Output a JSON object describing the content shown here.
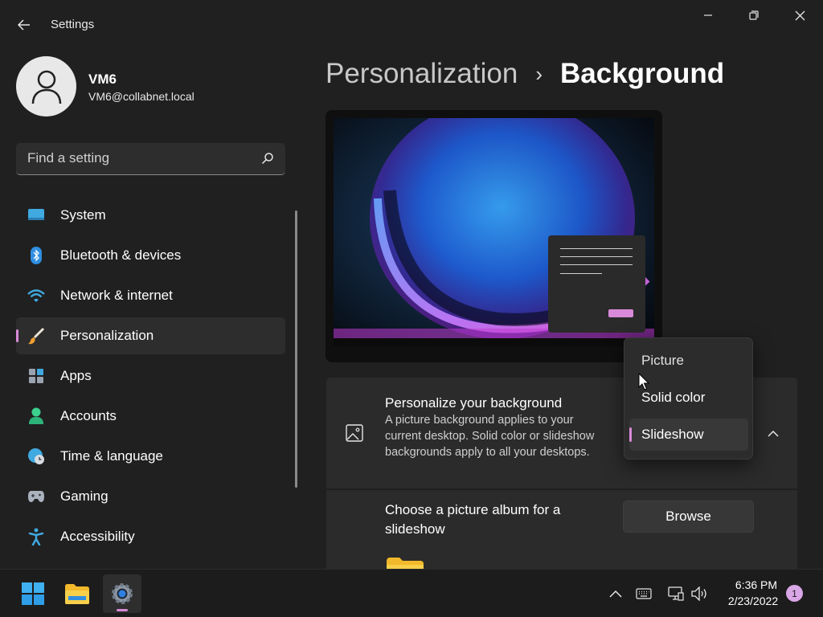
{
  "window": {
    "app_title": "Settings",
    "back_icon": "back-arrow-icon",
    "controls": [
      "minimize-icon",
      "restore-icon",
      "close-icon"
    ]
  },
  "user": {
    "name": "VM6",
    "email": "VM6@collabnet.local",
    "avatar_icon": "person-icon"
  },
  "search": {
    "placeholder": "Find a setting",
    "icon": "search-icon"
  },
  "sidebar": {
    "items": [
      {
        "label": "System",
        "icon": "system-icon",
        "active": false
      },
      {
        "label": "Bluetooth & devices",
        "icon": "bluetooth-icon",
        "active": false
      },
      {
        "label": "Network & internet",
        "icon": "wifi-icon",
        "active": false
      },
      {
        "label": "Personalization",
        "icon": "paintbrush-icon",
        "active": true
      },
      {
        "label": "Apps",
        "icon": "apps-icon",
        "active": false
      },
      {
        "label": "Accounts",
        "icon": "accounts-icon",
        "active": false
      },
      {
        "label": "Time & language",
        "icon": "globe-clock-icon",
        "active": false
      },
      {
        "label": "Gaming",
        "icon": "gamepad-icon",
        "active": false
      },
      {
        "label": "Accessibility",
        "icon": "accessibility-icon",
        "active": false
      }
    ]
  },
  "breadcrumb": {
    "parent": "Personalization",
    "separator": "›",
    "current": "Background"
  },
  "background_card": {
    "title": "Personalize your background",
    "description": "A picture background applies to your current desktop. Solid color or slideshow backgrounds apply to all your desktops.",
    "icon": "picture-icon",
    "expand_icon": "chevron-up-icon"
  },
  "dropdown": {
    "options": [
      "Picture",
      "Solid color",
      "Slideshow"
    ],
    "selected": "Slideshow"
  },
  "album_card": {
    "title": "Choose a picture album for a slideshow",
    "button_label": "Browse",
    "folder_icon": "folder-icon"
  },
  "taskbar": {
    "apps": [
      "windows-start-icon",
      "file-explorer-icon",
      "settings-icon"
    ],
    "tray": [
      "chevron-up-icon",
      "keyboard-icon",
      "network-icon",
      "volume-icon"
    ],
    "time": "6:36 PM",
    "date": "2/23/2022",
    "notification_count": "1"
  },
  "colors": {
    "accent": "#d98ad8",
    "background": "#202020",
    "card": "#2b2b2b"
  }
}
